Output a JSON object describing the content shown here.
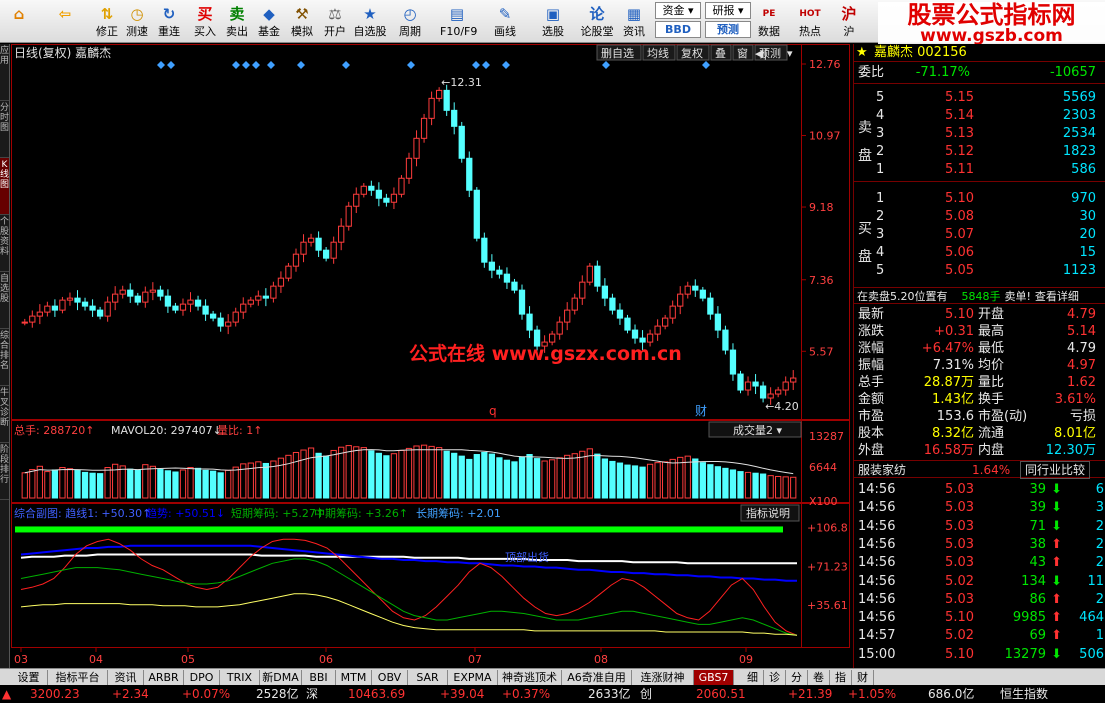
{
  "toolbar": {
    "buttons": [
      {
        "label": "",
        "icon": "home-icon",
        "sym": "⌂",
        "color": "#e08000"
      },
      {
        "label": "",
        "icon": "back-arrow-icon",
        "sym": "⇦",
        "color": "#f0a000"
      },
      {
        "label": "修正",
        "icon": "up-down-arrows-icon",
        "sym": "⇅",
        "color": "#e0a000"
      },
      {
        "label": "测速",
        "icon": "clock-icon",
        "sym": "◷",
        "color": "#d09000"
      },
      {
        "label": "重连",
        "icon": "reconnect-icon",
        "sym": "↻",
        "color": "#2060c0"
      },
      {
        "label": "买入",
        "icon": "buy-icon",
        "sym": "买",
        "color": "#e00000"
      },
      {
        "label": "卖出",
        "icon": "sell-icon",
        "sym": "卖",
        "color": "#008000"
      },
      {
        "label": "基金",
        "icon": "fund-icon",
        "sym": "◆",
        "color": "#2060c0"
      },
      {
        "label": "模拟",
        "icon": "hammer-icon",
        "sym": "⚒",
        "color": "#805000"
      },
      {
        "label": "开户",
        "icon": "scales-icon",
        "sym": "⚖",
        "color": "#606060"
      },
      {
        "label": "自选股",
        "icon": "star-icon",
        "sym": "★",
        "color": "#2060c0"
      },
      {
        "label": "周期",
        "icon": "period-icon",
        "sym": "◴",
        "color": "#2060c0"
      },
      {
        "label": "F10/F9",
        "icon": "f10-icon",
        "sym": "▤",
        "color": "#2060c0"
      },
      {
        "label": "画线",
        "icon": "draw-line-icon",
        "sym": "✎",
        "color": "#2060c0"
      },
      {
        "label": "选股",
        "icon": "screener-icon",
        "sym": "▣",
        "color": "#2060c0"
      },
      {
        "label": "论股堂",
        "icon": "forum-icon",
        "sym": "论",
        "color": "#2060c0"
      },
      {
        "label": "资讯",
        "icon": "news-icon",
        "sym": "▦",
        "color": "#2060c0"
      },
      {
        "label": "数据",
        "icon": "data-icon",
        "sym": "PE",
        "color": "#c00000"
      },
      {
        "label": "热点",
        "icon": "hot-icon",
        "sym": "HOT",
        "color": "#c00000"
      },
      {
        "label": "沪",
        "icon": "shanghai-icon",
        "sym": "沪",
        "color": "#c00000"
      }
    ],
    "dropdowns": [
      {
        "label": "资金",
        "sub": "BBD"
      },
      {
        "label": "研报",
        "sub": "预测"
      }
    ]
  },
  "watermark": {
    "top_line1": "股票公式指标网",
    "top_line2": "www.gszb.com",
    "center": "公式在线 www.gszx.com.cn"
  },
  "left_tabs": [
    "应用",
    "分时图",
    "K线图",
    "个股资料",
    "自选股",
    "综合排名",
    "牛叉诊断",
    "阶段排行"
  ],
  "chart_header": {
    "title": "日线(复权) 嘉麟杰",
    "buttons": [
      "删自选",
      "均线",
      "复权",
      "叠",
      "窗",
      "预测"
    ]
  },
  "chart_data": [
    {
      "type": "candlestick",
      "title": "日线(复权) 嘉麟杰",
      "x_ticks": [
        "03",
        "04",
        "05",
        "06",
        "07",
        "08",
        "09"
      ],
      "y_ticks": [
        "12.76",
        "10.97",
        "9.18",
        "7.36",
        "5.57"
      ],
      "ylim": [
        4.0,
        12.76
      ],
      "annotations": [
        {
          "text": "12.31",
          "kind": "high"
        },
        {
          "text": "4.20",
          "kind": "low"
        },
        {
          "text": "q",
          "kind": "marker"
        },
        {
          "text": "财",
          "kind": "marker"
        }
      ],
      "series": [
        {
          "name": "close",
          "values": [
            6.3,
            6.45,
            6.55,
            6.7,
            6.6,
            6.85,
            6.9,
            6.8,
            6.7,
            6.6,
            6.45,
            6.8,
            7.0,
            7.1,
            6.95,
            6.8,
            7.05,
            7.1,
            6.95,
            6.7,
            6.6,
            6.75,
            6.85,
            6.7,
            6.5,
            6.4,
            6.2,
            6.3,
            6.55,
            6.75,
            6.85,
            6.95,
            6.9,
            7.2,
            7.4,
            7.7,
            8.0,
            8.3,
            8.4,
            8.1,
            7.9,
            8.3,
            8.7,
            9.2,
            9.5,
            9.7,
            9.6,
            9.4,
            9.3,
            9.5,
            9.9,
            10.4,
            10.9,
            11.4,
            11.9,
            12.1,
            11.6,
            11.2,
            10.4,
            9.6,
            8.4,
            7.8,
            7.6,
            7.5,
            7.3,
            7.1,
            6.5,
            6.1,
            5.7,
            5.8,
            6.0,
            6.3,
            6.6,
            6.9,
            7.3,
            7.7,
            7.2,
            6.9,
            6.6,
            6.4,
            6.1,
            5.9,
            5.8,
            6.0,
            6.2,
            6.4,
            6.7,
            7.0,
            7.2,
            7.1,
            6.9,
            6.5,
            6.1,
            5.6,
            5.0,
            4.6,
            4.8,
            4.7,
            4.4,
            4.5,
            4.6,
            4.8,
            4.9
          ]
        }
      ]
    },
    {
      "type": "bar",
      "title": "成交量2",
      "series": [
        {
          "name": "总手",
          "values": [
            6200,
            7000,
            7800,
            6500,
            6900,
            7500,
            7200,
            6800,
            6300,
            6100,
            6000,
            7500,
            8300,
            7900,
            7100,
            6800,
            8200,
            7800,
            7000,
            6700,
            6400,
            6900,
            7500,
            7300,
            6800,
            6600,
            6200,
            6800,
            7600,
            8400,
            8600,
            8900,
            8500,
            9100,
            9800,
            10500,
            11200,
            11800,
            12300,
            11000,
            10300,
            11700,
            12500,
            12900,
            12600,
            12400,
            11600,
            11000,
            10400,
            10900,
            11700,
            12200,
            12800,
            13000,
            12700,
            12400,
            11500,
            11000,
            10300,
            9500,
            10700,
            11200,
            10800,
            9900,
            9300,
            8900,
            10100,
            10700,
            9700,
            9100,
            9400,
            9900,
            10500,
            10900,
            11500,
            12100,
            10800,
            9600,
            9000,
            8600,
            8100,
            7900,
            7600,
            8300,
            8700,
            8900,
            9500,
            10000,
            10300,
            9600,
            8700,
            8200,
            7700,
            7300,
            6900,
            6500,
            6300,
            6100,
            5900,
            5500,
            5300,
            5200,
            5100
          ]
        }
      ],
      "legend": [
        "总手: 288720",
        "MAVOL20: 297407",
        "量比: 1"
      ],
      "y_ticks": [
        "13287",
        "6644",
        "X100"
      ]
    },
    {
      "type": "line",
      "title": "综合副图",
      "legend": [
        "综合副图: 趋线1: +50.30",
        "趋势: +50.51",
        "短期筹码: +5.27",
        "中期筹码: +3.26",
        "长期筹码: +2.01"
      ],
      "y_ticks": [
        "+106.8",
        "+71.23",
        "+35.61"
      ],
      "annotation": "顶部出货",
      "series": [
        {
          "name": "趋线1",
          "color": "#ffffff",
          "values": [
            79,
            80,
            80,
            80,
            81,
            81,
            81,
            82,
            82,
            82,
            82,
            82,
            82,
            82,
            82,
            82,
            82,
            82,
            82,
            82,
            82,
            82,
            81,
            81,
            81,
            81,
            81,
            80,
            80,
            80,
            80,
            80,
            80,
            80,
            80,
            80,
            79,
            79,
            79,
            79,
            79,
            78,
            78,
            78,
            78,
            78,
            78,
            77,
            77,
            77,
            77,
            76,
            76,
            76,
            76,
            76,
            75,
            75,
            75,
            75,
            75,
            74,
            74,
            74,
            74,
            74,
            74,
            74,
            74,
            74,
            74,
            74
          ]
        },
        {
          "name": "趋势",
          "color": "#0000ff",
          "values": [
            82,
            83,
            84,
            85,
            86,
            87,
            88,
            88,
            89,
            89,
            90,
            90,
            90,
            90,
            90,
            90,
            90,
            90,
            90,
            90,
            90,
            90,
            89,
            88,
            87,
            86,
            85,
            84,
            83,
            82,
            81,
            80,
            79,
            78,
            78,
            77,
            77,
            76,
            76,
            75,
            75,
            74,
            74,
            73,
            72,
            72,
            71,
            71,
            70,
            70,
            69,
            68,
            68,
            67,
            66,
            66,
            65,
            65,
            64,
            64,
            63,
            63,
            62,
            62,
            61,
            61,
            60,
            60,
            59,
            59,
            58,
            58
          ]
        },
        {
          "name": "短期筹码",
          "color": "#ff2020",
          "values": [
            50,
            52,
            55,
            60,
            70,
            82,
            90,
            94,
            96,
            92,
            86,
            78,
            72,
            68,
            62,
            56,
            52,
            50,
            52,
            60,
            70,
            80,
            88,
            94,
            96,
            96,
            95,
            92,
            88,
            80,
            70,
            60,
            50,
            40,
            30,
            24,
            22,
            26,
            34,
            44,
            54,
            66,
            74,
            70,
            62,
            52,
            42,
            34,
            28,
            26,
            28,
            32,
            38,
            46,
            54,
            60,
            58,
            52,
            44,
            36,
            28,
            24,
            22,
            30,
            42,
            54,
            60,
            50,
            34,
            20,
            12,
            8
          ]
        },
        {
          "name": "中期筹码",
          "color": "#00b000",
          "values": [
            60,
            62,
            64,
            66,
            68,
            70,
            70,
            70,
            69,
            68,
            66,
            64,
            62,
            60,
            58,
            56,
            55,
            55,
            56,
            58,
            62,
            66,
            70,
            74,
            76,
            78,
            78,
            76,
            72,
            66,
            60,
            54,
            48,
            42,
            36,
            30,
            26,
            24,
            22,
            22,
            24,
            26,
            28,
            30,
            30,
            29,
            28,
            26,
            24,
            22,
            22,
            22,
            24,
            26,
            28,
            30,
            30,
            28,
            26,
            24,
            22,
            20,
            18,
            18,
            20,
            22,
            24,
            22,
            18,
            14,
            10,
            8
          ]
        },
        {
          "name": "长期筹码",
          "color": "#ffff66",
          "values": [
            34,
            35,
            36,
            36,
            37,
            37,
            37,
            37,
            37,
            37,
            36,
            36,
            36,
            35,
            35,
            35,
            34,
            34,
            34,
            35,
            36,
            38,
            40,
            42,
            44,
            46,
            46,
            45,
            43,
            40,
            36,
            32,
            28,
            24,
            20,
            17,
            15,
            14,
            13,
            13,
            13,
            13,
            13,
            13,
            13,
            13,
            13,
            12,
            12,
            12,
            12,
            12,
            12,
            12,
            12,
            12,
            12,
            12,
            12,
            11,
            11,
            11,
            11,
            11,
            11,
            11,
            11,
            10,
            10,
            9,
            9,
            8
          ]
        }
      ]
    }
  ],
  "quote_panel": {
    "stock_title": "嘉麟杰 002156",
    "webi": {
      "label": "委比",
      "pct": "-71.17%",
      "diff": "-10657"
    },
    "sell_label": [
      "卖",
      "盘"
    ],
    "buy_label": [
      "买",
      "盘"
    ],
    "sells": [
      {
        "lvl": "5",
        "price": "5.15",
        "vol": "5569"
      },
      {
        "lvl": "4",
        "price": "5.14",
        "vol": "2303"
      },
      {
        "lvl": "3",
        "price": "5.13",
        "vol": "2534"
      },
      {
        "lvl": "2",
        "price": "5.12",
        "vol": "1823"
      },
      {
        "lvl": "1",
        "price": "5.11",
        "vol": "586"
      }
    ],
    "buys": [
      {
        "lvl": "1",
        "price": "5.10",
        "vol": "970"
      },
      {
        "lvl": "2",
        "price": "5.08",
        "vol": "30"
      },
      {
        "lvl": "3",
        "price": "5.07",
        "vol": "20"
      },
      {
        "lvl": "4",
        "price": "5.06",
        "vol": "15"
      },
      {
        "lvl": "5",
        "price": "5.05",
        "vol": "1123"
      }
    ],
    "notice": {
      "text": "在卖盘5.20位置有",
      "vol": "5848手",
      "tail": "卖单!",
      "link": "查看详细"
    },
    "stats": [
      [
        "最新",
        "5.10",
        "开盘",
        "4.79"
      ],
      [
        "涨跌",
        "+0.31",
        "最高",
        "5.14"
      ],
      [
        "涨幅",
        "+6.47%",
        "最低",
        "4.79"
      ],
      [
        "振幅",
        "7.31%",
        "均价",
        "4.97"
      ],
      [
        "总手",
        "28.87万",
        "量比",
        "1.62"
      ],
      [
        "金额",
        "1.43亿",
        "换手",
        "3.61%"
      ],
      [
        "市盈",
        "153.6",
        "市盈(动)",
        "亏损"
      ],
      [
        "股本",
        "8.32亿",
        "流通",
        "8.01亿"
      ],
      [
        "外盘",
        "16.58万",
        "内盘",
        "12.30万"
      ]
    ],
    "industry": {
      "name": "服装家纺",
      "pct": "1.64%",
      "compare": "同行业比较"
    },
    "ticks": [
      {
        "time": "14:56",
        "price": "5.03",
        "vol": "39",
        "dir": "down",
        "n": "6"
      },
      {
        "time": "14:56",
        "price": "5.03",
        "vol": "39",
        "dir": "down",
        "n": "3"
      },
      {
        "time": "14:56",
        "price": "5.03",
        "vol": "71",
        "dir": "down",
        "n": "2"
      },
      {
        "time": "14:56",
        "price": "5.03",
        "vol": "38",
        "dir": "up",
        "n": "2"
      },
      {
        "time": "14:56",
        "price": "5.03",
        "vol": "43",
        "dir": "up",
        "n": "2"
      },
      {
        "time": "14:56",
        "price": "5.02",
        "vol": "134",
        "dir": "down",
        "n": "11"
      },
      {
        "time": "14:56",
        "price": "5.03",
        "vol": "86",
        "dir": "up",
        "n": "2"
      },
      {
        "time": "14:56",
        "price": "5.10",
        "vol": "9985",
        "dir": "up",
        "n": "464"
      },
      {
        "time": "14:57",
        "price": "5.02",
        "vol": "69",
        "dir": "up",
        "n": "1"
      },
      {
        "time": "15:00",
        "price": "5.10",
        "vol": "13279",
        "dir": "down",
        "n": "506"
      }
    ]
  },
  "bottom_tabs": [
    "设置",
    "指标平台",
    "资讯",
    "ARBR",
    "DPO",
    "TRIX",
    "新DMA",
    "BBI",
    "MTM",
    "OBV",
    "SAR",
    "EXPMA",
    "神奇逃顶术",
    "A6奇准自用",
    "连涨财神",
    "GBS7",
    "细",
    "诊",
    "分",
    "卷",
    "指",
    "财"
  ],
  "status": {
    "idx1": "3200.23",
    "chg1": "+2.34",
    "pct1": "+0.07%",
    "amt1": "2528亿",
    "name2": "深",
    "idx2": "10463.69",
    "chg2": "+39.04",
    "pct2": "+0.37%",
    "amt2": "2633亿",
    "name3": "创",
    "idx3": "2060.51",
    "chg3": "+21.39",
    "pct3": "+1.05%",
    "amt3": "686.0亿",
    "tail": "恒生指数"
  }
}
